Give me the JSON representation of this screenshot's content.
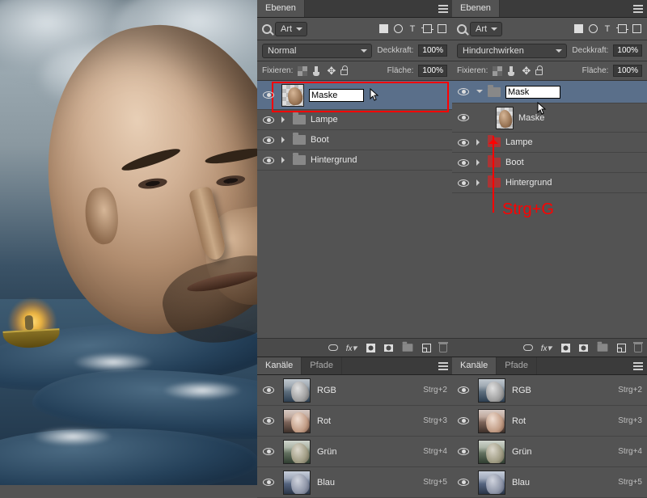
{
  "panels": {
    "layers_tab": "Ebenen",
    "channels_tab": "Kanäle",
    "paths_tab": "Pfade"
  },
  "toolbar": {
    "filter_label": "Art",
    "blend_normal": "Normal",
    "blend_passthrough": "Hindurchwirken",
    "opacity_label": "Deckkraft:",
    "opacity_value": "100%",
    "lock_label": "Fixieren:",
    "fill_label": "Fläche:",
    "fill_value": "100%"
  },
  "left_layers": {
    "editing_name": "Maske",
    "items": [
      {
        "name": "Lampe"
      },
      {
        "name": "Boot"
      },
      {
        "name": "Hintergrund"
      }
    ]
  },
  "right_layers": {
    "group_editing_name": "Mask",
    "child_name": "Maske",
    "items": [
      {
        "name": "Lampe"
      },
      {
        "name": "Boot"
      },
      {
        "name": "Hintergrund"
      }
    ]
  },
  "channels": [
    {
      "name": "RGB",
      "shortcut": "Strg+2",
      "cls": ""
    },
    {
      "name": "Rot",
      "shortcut": "Strg+3",
      "cls": "red"
    },
    {
      "name": "Grün",
      "shortcut": "Strg+4",
      "cls": "green"
    },
    {
      "name": "Blau",
      "shortcut": "Strg+5",
      "cls": "blue"
    }
  ],
  "annotation": {
    "text": "Strg+G"
  }
}
